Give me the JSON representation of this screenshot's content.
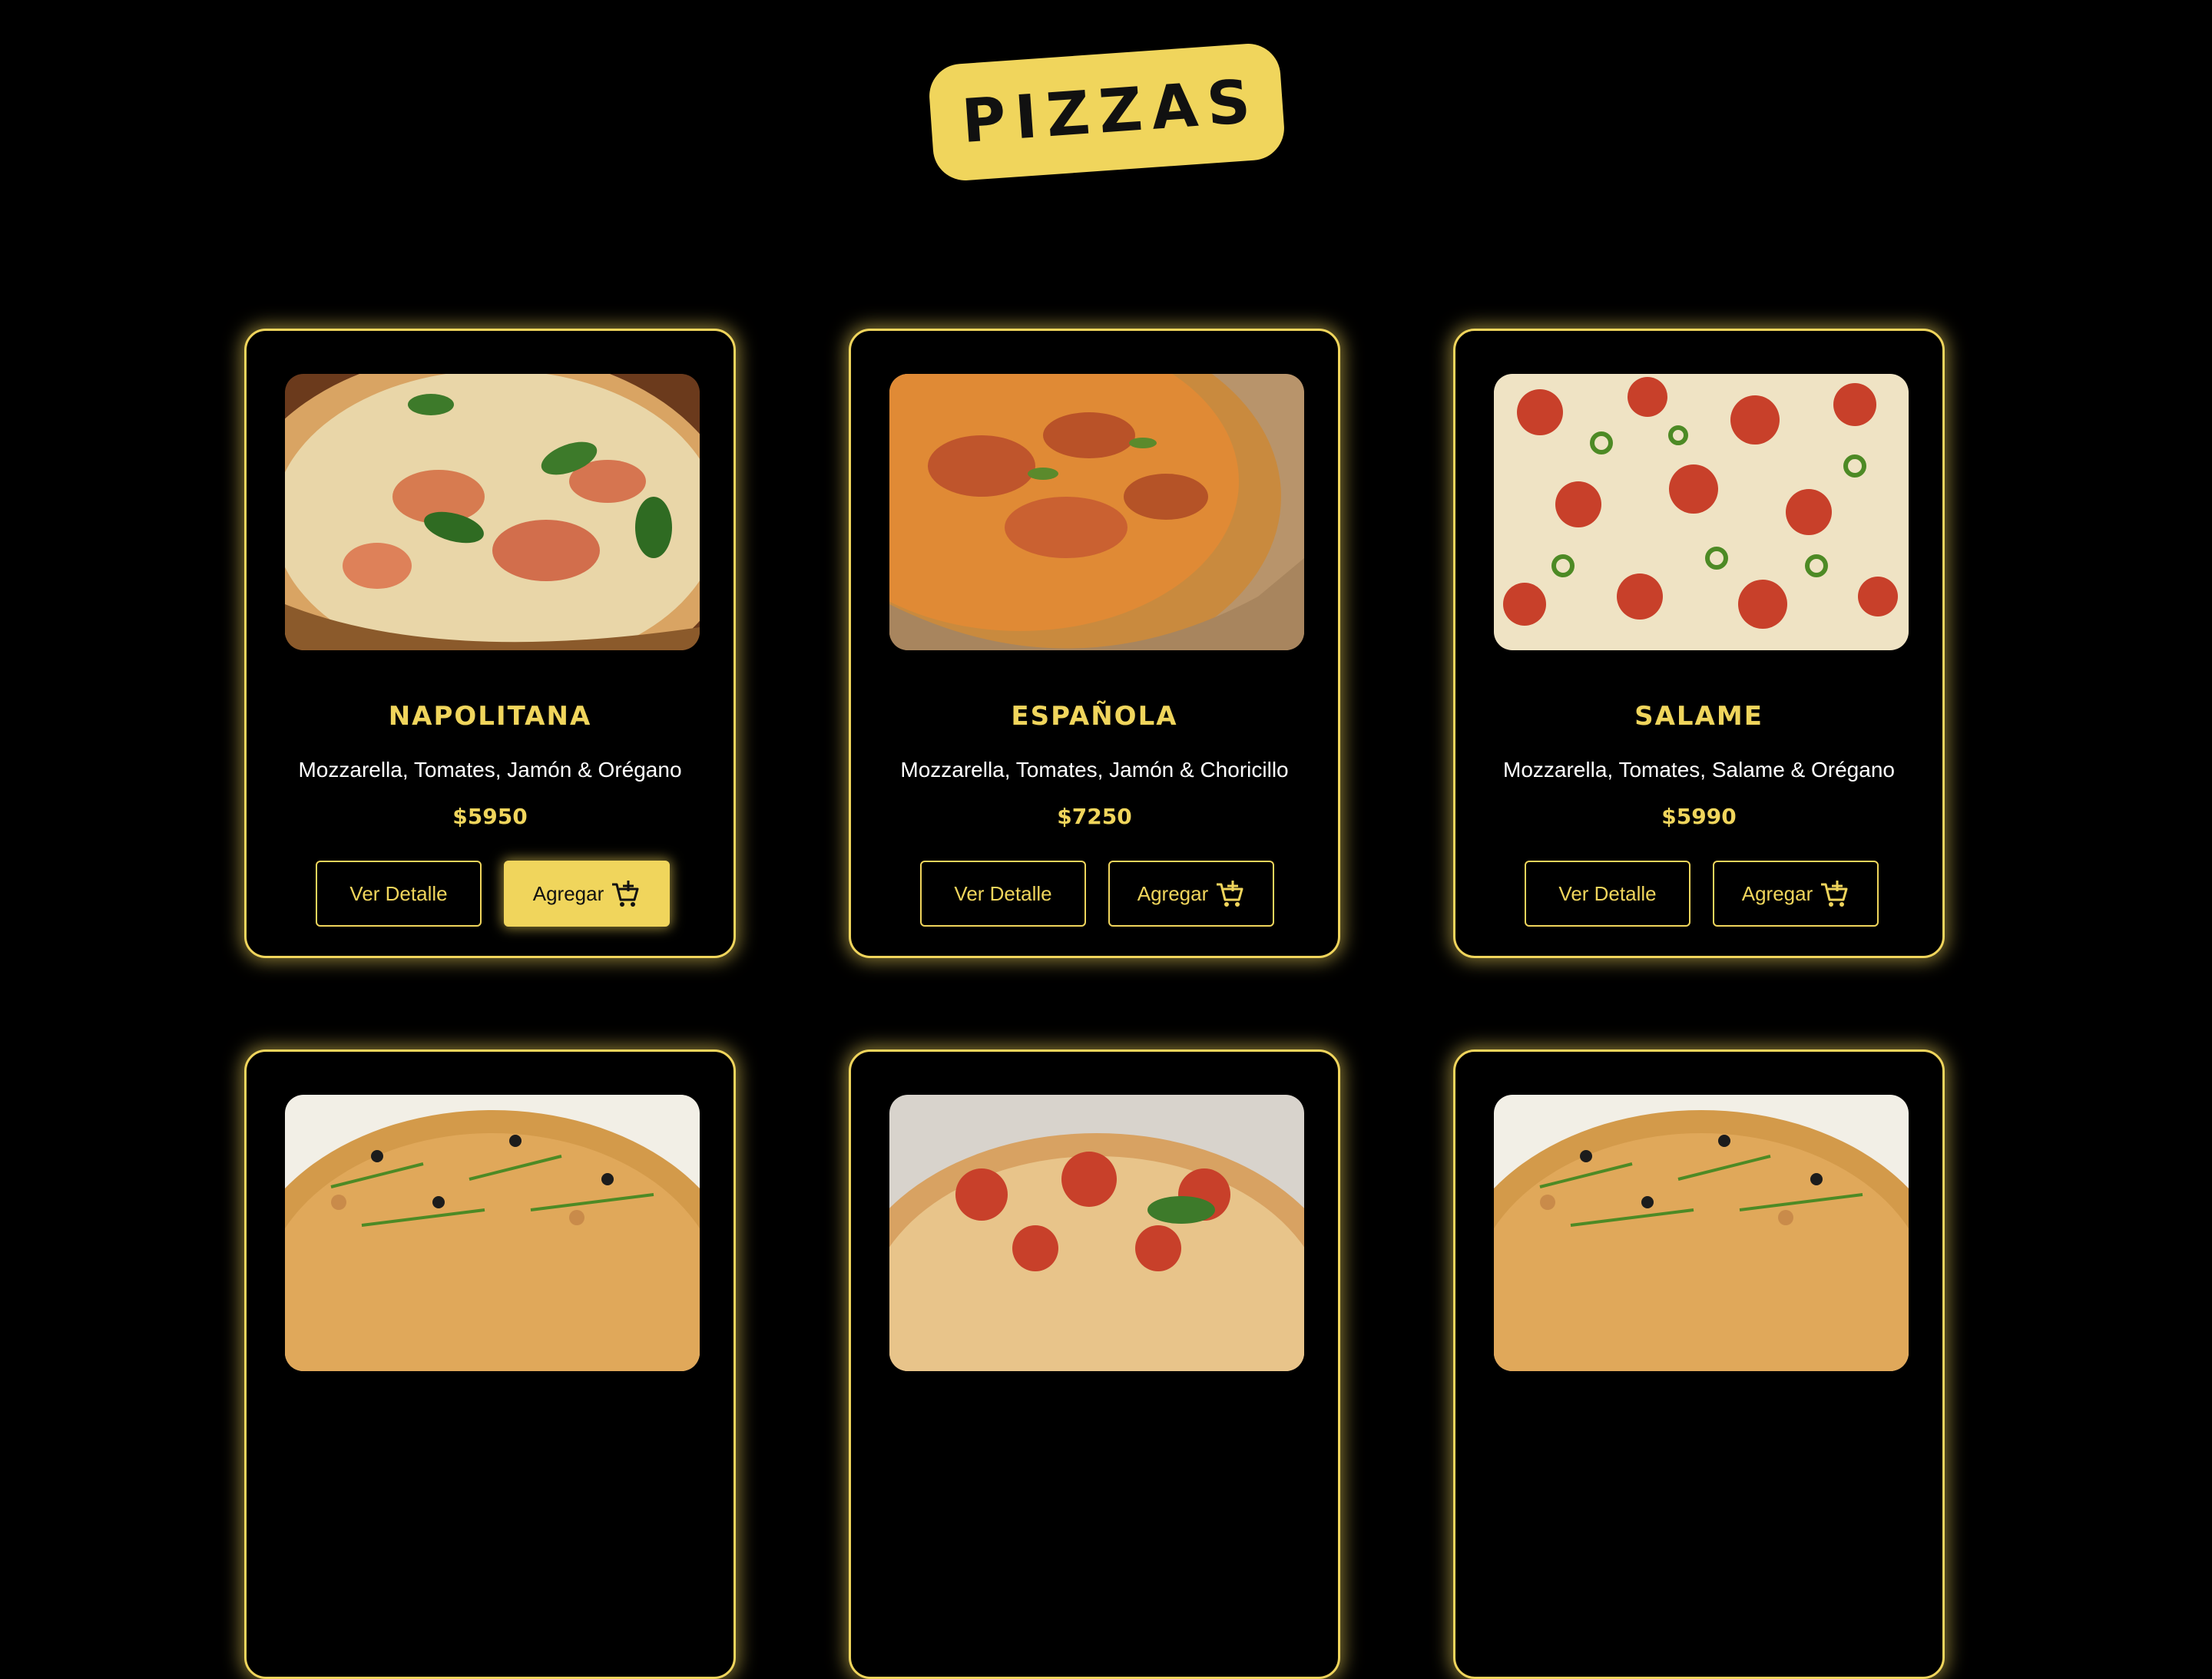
{
  "header": {
    "title": "PIZZAS"
  },
  "colors": {
    "background": "#000000",
    "accent": "#f0d55c",
    "text": "#ffffff"
  },
  "cards": [
    {
      "name": "NAPOLITANA",
      "description": "Mozzarella, Tomates, Jamón & Orégano",
      "price": "$5950",
      "detail_label": "Ver Detalle",
      "add_label": "Agregar",
      "add_active": true
    },
    {
      "name": "ESPAÑOLA",
      "description": "Mozzarella, Tomates, Jamón & Choricillo",
      "price": "$7250",
      "detail_label": "Ver Detalle",
      "add_label": "Agregar",
      "add_active": false
    },
    {
      "name": "SALAME",
      "description": "Mozzarella, Tomates, Salame & Orégano",
      "price": "$5990",
      "detail_label": "Ver Detalle",
      "add_label": "Agregar",
      "add_active": false
    },
    {
      "name": "",
      "description": "",
      "price": "",
      "detail_label": "",
      "add_label": ""
    },
    {
      "name": "",
      "description": "",
      "price": "",
      "detail_label": "",
      "add_label": ""
    },
    {
      "name": "",
      "description": "",
      "price": "",
      "detail_label": "",
      "add_label": ""
    }
  ],
  "icons": {
    "add_to_cart": "cart-plus-icon"
  }
}
